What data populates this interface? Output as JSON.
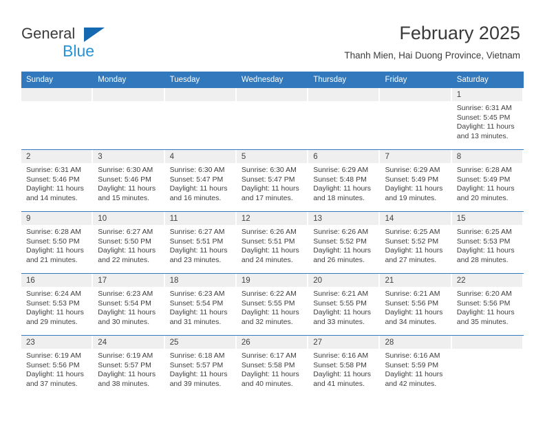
{
  "brand": {
    "name_part1": "General",
    "name_part2": "Blue",
    "logo_icon": "triangle-logo-icon"
  },
  "header": {
    "title": "February 2025",
    "subtitle": "Thanh Mien, Hai Duong Province, Vietnam"
  },
  "calendar": {
    "weekday_headers": [
      "Sunday",
      "Monday",
      "Tuesday",
      "Wednesday",
      "Thursday",
      "Friday",
      "Saturday"
    ],
    "colors": {
      "header_blue": "#3179bc",
      "daynum_band": "#efefef",
      "text": "#3d3d3d",
      "brand_blue": "#2792d8",
      "brand_triangle": "#1569b0"
    },
    "weeks": [
      [
        {
          "day": "",
          "blank": true
        },
        {
          "day": "",
          "blank": true
        },
        {
          "day": "",
          "blank": true
        },
        {
          "day": "",
          "blank": true
        },
        {
          "day": "",
          "blank": true
        },
        {
          "day": "",
          "blank": true
        },
        {
          "day": "1",
          "sunrise": "Sunrise: 6:31 AM",
          "sunset": "Sunset: 5:45 PM",
          "daylight_line1": "Daylight: 11 hours",
          "daylight_line2": "and 13 minutes."
        }
      ],
      [
        {
          "day": "2",
          "sunrise": "Sunrise: 6:31 AM",
          "sunset": "Sunset: 5:46 PM",
          "daylight_line1": "Daylight: 11 hours",
          "daylight_line2": "and 14 minutes."
        },
        {
          "day": "3",
          "sunrise": "Sunrise: 6:30 AM",
          "sunset": "Sunset: 5:46 PM",
          "daylight_line1": "Daylight: 11 hours",
          "daylight_line2": "and 15 minutes."
        },
        {
          "day": "4",
          "sunrise": "Sunrise: 6:30 AM",
          "sunset": "Sunset: 5:47 PM",
          "daylight_line1": "Daylight: 11 hours",
          "daylight_line2": "and 16 minutes."
        },
        {
          "day": "5",
          "sunrise": "Sunrise: 6:30 AM",
          "sunset": "Sunset: 5:47 PM",
          "daylight_line1": "Daylight: 11 hours",
          "daylight_line2": "and 17 minutes."
        },
        {
          "day": "6",
          "sunrise": "Sunrise: 6:29 AM",
          "sunset": "Sunset: 5:48 PM",
          "daylight_line1": "Daylight: 11 hours",
          "daylight_line2": "and 18 minutes."
        },
        {
          "day": "7",
          "sunrise": "Sunrise: 6:29 AM",
          "sunset": "Sunset: 5:49 PM",
          "daylight_line1": "Daylight: 11 hours",
          "daylight_line2": "and 19 minutes."
        },
        {
          "day": "8",
          "sunrise": "Sunrise: 6:28 AM",
          "sunset": "Sunset: 5:49 PM",
          "daylight_line1": "Daylight: 11 hours",
          "daylight_line2": "and 20 minutes."
        }
      ],
      [
        {
          "day": "9",
          "sunrise": "Sunrise: 6:28 AM",
          "sunset": "Sunset: 5:50 PM",
          "daylight_line1": "Daylight: 11 hours",
          "daylight_line2": "and 21 minutes."
        },
        {
          "day": "10",
          "sunrise": "Sunrise: 6:27 AM",
          "sunset": "Sunset: 5:50 PM",
          "daylight_line1": "Daylight: 11 hours",
          "daylight_line2": "and 22 minutes."
        },
        {
          "day": "11",
          "sunrise": "Sunrise: 6:27 AM",
          "sunset": "Sunset: 5:51 PM",
          "daylight_line1": "Daylight: 11 hours",
          "daylight_line2": "and 23 minutes."
        },
        {
          "day": "12",
          "sunrise": "Sunrise: 6:26 AM",
          "sunset": "Sunset: 5:51 PM",
          "daylight_line1": "Daylight: 11 hours",
          "daylight_line2": "and 24 minutes."
        },
        {
          "day": "13",
          "sunrise": "Sunrise: 6:26 AM",
          "sunset": "Sunset: 5:52 PM",
          "daylight_line1": "Daylight: 11 hours",
          "daylight_line2": "and 26 minutes."
        },
        {
          "day": "14",
          "sunrise": "Sunrise: 6:25 AM",
          "sunset": "Sunset: 5:52 PM",
          "daylight_line1": "Daylight: 11 hours",
          "daylight_line2": "and 27 minutes."
        },
        {
          "day": "15",
          "sunrise": "Sunrise: 6:25 AM",
          "sunset": "Sunset: 5:53 PM",
          "daylight_line1": "Daylight: 11 hours",
          "daylight_line2": "and 28 minutes."
        }
      ],
      [
        {
          "day": "16",
          "sunrise": "Sunrise: 6:24 AM",
          "sunset": "Sunset: 5:53 PM",
          "daylight_line1": "Daylight: 11 hours",
          "daylight_line2": "and 29 minutes."
        },
        {
          "day": "17",
          "sunrise": "Sunrise: 6:23 AM",
          "sunset": "Sunset: 5:54 PM",
          "daylight_line1": "Daylight: 11 hours",
          "daylight_line2": "and 30 minutes."
        },
        {
          "day": "18",
          "sunrise": "Sunrise: 6:23 AM",
          "sunset": "Sunset: 5:54 PM",
          "daylight_line1": "Daylight: 11 hours",
          "daylight_line2": "and 31 minutes."
        },
        {
          "day": "19",
          "sunrise": "Sunrise: 6:22 AM",
          "sunset": "Sunset: 5:55 PM",
          "daylight_line1": "Daylight: 11 hours",
          "daylight_line2": "and 32 minutes."
        },
        {
          "day": "20",
          "sunrise": "Sunrise: 6:21 AM",
          "sunset": "Sunset: 5:55 PM",
          "daylight_line1": "Daylight: 11 hours",
          "daylight_line2": "and 33 minutes."
        },
        {
          "day": "21",
          "sunrise": "Sunrise: 6:21 AM",
          "sunset": "Sunset: 5:56 PM",
          "daylight_line1": "Daylight: 11 hours",
          "daylight_line2": "and 34 minutes."
        },
        {
          "day": "22",
          "sunrise": "Sunrise: 6:20 AM",
          "sunset": "Sunset: 5:56 PM",
          "daylight_line1": "Daylight: 11 hours",
          "daylight_line2": "and 35 minutes."
        }
      ],
      [
        {
          "day": "23",
          "sunrise": "Sunrise: 6:19 AM",
          "sunset": "Sunset: 5:56 PM",
          "daylight_line1": "Daylight: 11 hours",
          "daylight_line2": "and 37 minutes."
        },
        {
          "day": "24",
          "sunrise": "Sunrise: 6:19 AM",
          "sunset": "Sunset: 5:57 PM",
          "daylight_line1": "Daylight: 11 hours",
          "daylight_line2": "and 38 minutes."
        },
        {
          "day": "25",
          "sunrise": "Sunrise: 6:18 AM",
          "sunset": "Sunset: 5:57 PM",
          "daylight_line1": "Daylight: 11 hours",
          "daylight_line2": "and 39 minutes."
        },
        {
          "day": "26",
          "sunrise": "Sunrise: 6:17 AM",
          "sunset": "Sunset: 5:58 PM",
          "daylight_line1": "Daylight: 11 hours",
          "daylight_line2": "and 40 minutes."
        },
        {
          "day": "27",
          "sunrise": "Sunrise: 6:16 AM",
          "sunset": "Sunset: 5:58 PM",
          "daylight_line1": "Daylight: 11 hours",
          "daylight_line2": "and 41 minutes."
        },
        {
          "day": "28",
          "sunrise": "Sunrise: 6:16 AM",
          "sunset": "Sunset: 5:59 PM",
          "daylight_line1": "Daylight: 11 hours",
          "daylight_line2": "and 42 minutes."
        },
        {
          "day": "",
          "blank": true
        }
      ]
    ]
  }
}
